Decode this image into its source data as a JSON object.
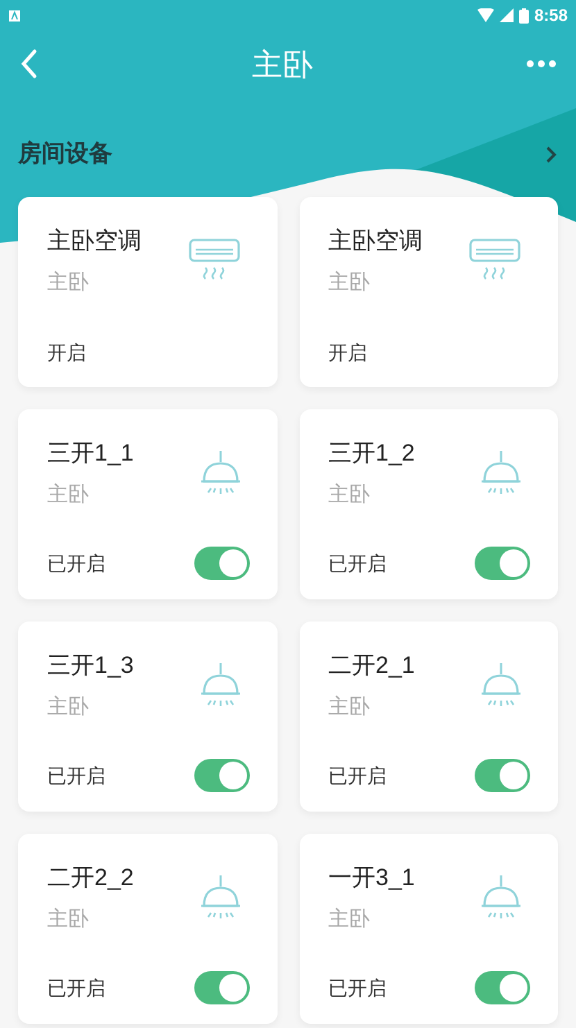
{
  "status_bar": {
    "time": "8:58"
  },
  "header": {
    "title": "主卧"
  },
  "section": {
    "title": "房间设备"
  },
  "devices": [
    {
      "kind": "ac",
      "name": "主卧空调",
      "room": "主卧",
      "status": "开启"
    },
    {
      "kind": "ac",
      "name": "主卧空调",
      "room": "主卧",
      "status": "开启"
    },
    {
      "kind": "light",
      "name": "三开1_1",
      "room": "主卧",
      "status": "已开启",
      "on": true
    },
    {
      "kind": "light",
      "name": "三开1_2",
      "room": "主卧",
      "status": "已开启",
      "on": true
    },
    {
      "kind": "light",
      "name": "三开1_3",
      "room": "主卧",
      "status": "已开启",
      "on": true
    },
    {
      "kind": "light",
      "name": "二开2_1",
      "room": "主卧",
      "status": "已开启",
      "on": true
    },
    {
      "kind": "light",
      "name": "二开2_2",
      "room": "主卧",
      "status": "已开启",
      "on": true
    },
    {
      "kind": "light",
      "name": "一开3_1",
      "room": "主卧",
      "status": "已开启",
      "on": true
    }
  ]
}
